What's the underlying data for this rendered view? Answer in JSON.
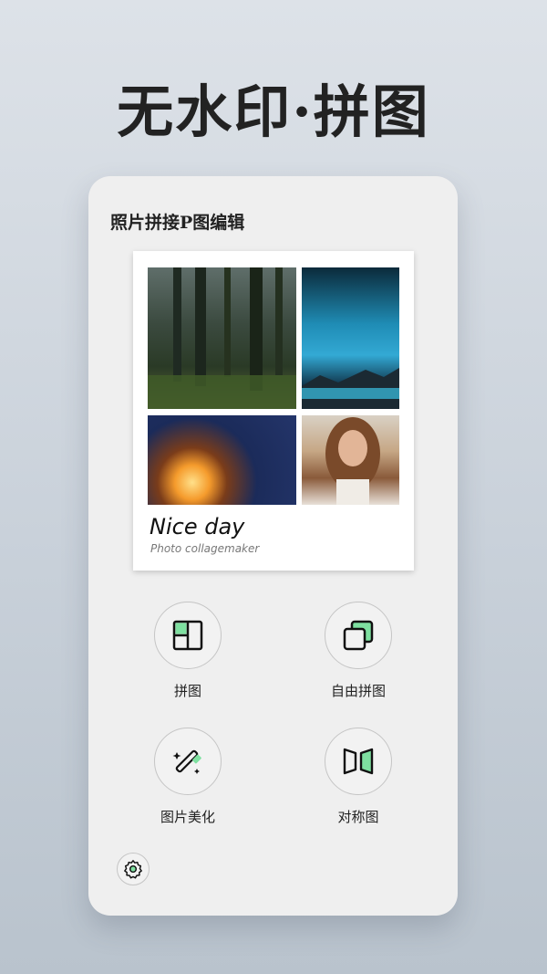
{
  "hero": {
    "title": "无水印·拼图"
  },
  "card": {
    "title": "照片拼接P图编辑",
    "collage": {
      "caption_main": "Nice day",
      "caption_sub": "Photo collagemaker",
      "photos": [
        "forest",
        "aurora-lake",
        "campfire",
        "portrait"
      ]
    },
    "features": [
      {
        "label": "拼图",
        "icon": "grid-layout-icon"
      },
      {
        "label": "自由拼图",
        "icon": "overlap-squares-icon"
      },
      {
        "label": "图片美化",
        "icon": "magic-wand-icon"
      },
      {
        "label": "对称图",
        "icon": "mirror-icon"
      }
    ],
    "settings_icon": "gear-icon"
  },
  "colors": {
    "accent": "#7ee0a0",
    "background": "#c9d1da",
    "card": "#efefef"
  }
}
